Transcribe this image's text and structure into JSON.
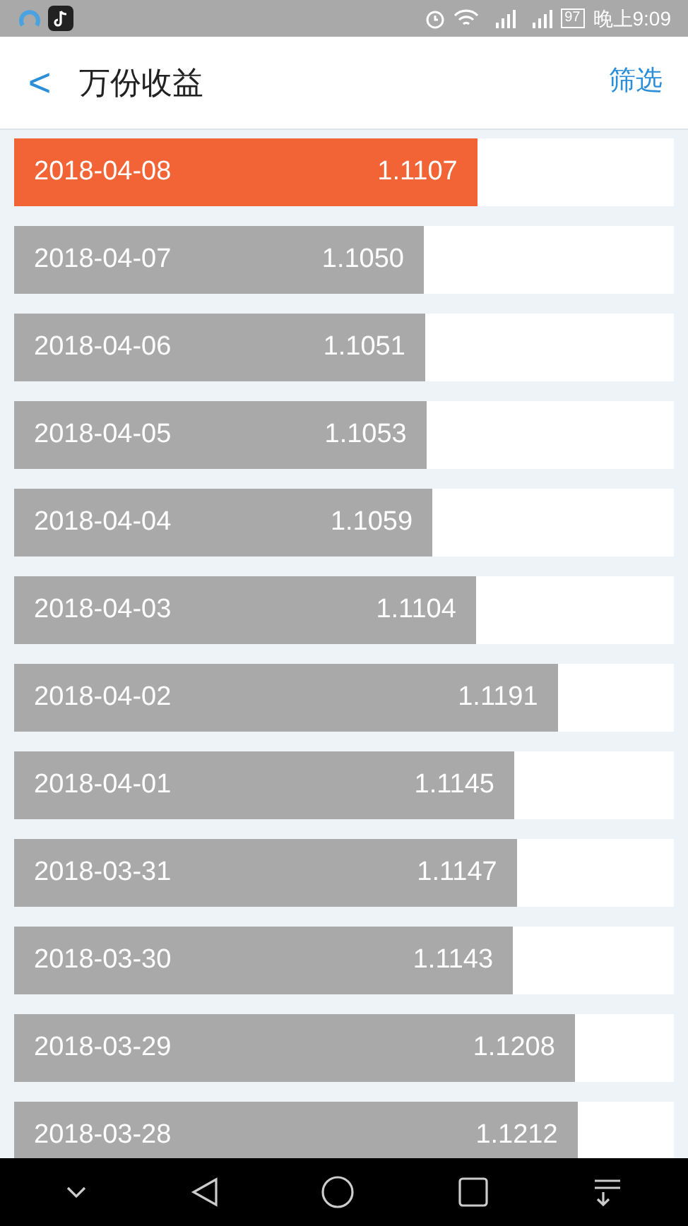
{
  "status_bar": {
    "battery": "97",
    "time": "晚上9:09"
  },
  "header": {
    "back": "<",
    "title": "万份收益",
    "action": "筛选"
  },
  "rows": [
    {
      "date": "2018-04-08",
      "value": "1.1107",
      "level": 0.702,
      "selected": true
    },
    {
      "date": "2018-04-07",
      "value": "1.1050",
      "level": 0.621,
      "selected": false
    },
    {
      "date": "2018-04-06",
      "value": "1.1051",
      "level": 0.623,
      "selected": false
    },
    {
      "date": "2018-04-05",
      "value": "1.1053",
      "level": 0.625,
      "selected": false
    },
    {
      "date": "2018-04-04",
      "value": "1.1059",
      "level": 0.634,
      "selected": false
    },
    {
      "date": "2018-04-03",
      "value": "1.1104",
      "level": 0.7,
      "selected": false
    },
    {
      "date": "2018-04-02",
      "value": "1.1191",
      "level": 0.824,
      "selected": false
    },
    {
      "date": "2018-04-01",
      "value": "1.1145",
      "level": 0.758,
      "selected": false
    },
    {
      "date": "2018-03-31",
      "value": "1.1147",
      "level": 0.762,
      "selected": false
    },
    {
      "date": "2018-03-30",
      "value": "1.1143",
      "level": 0.756,
      "selected": false
    },
    {
      "date": "2018-03-29",
      "value": "1.1208",
      "level": 0.85,
      "selected": false
    },
    {
      "date": "2018-03-28",
      "value": "1.1212",
      "level": 0.854,
      "selected": false
    }
  ]
}
